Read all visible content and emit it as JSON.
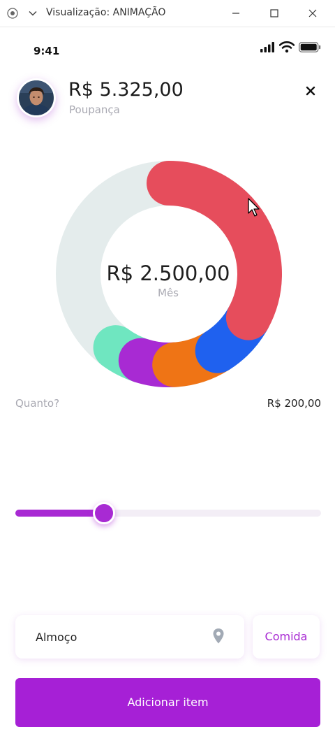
{
  "window": {
    "title": "Visualização: ANIMAÇÃO"
  },
  "status_bar": {
    "time": "9:41",
    "icons": [
      "signal-icon",
      "wifi-icon",
      "battery-icon"
    ]
  },
  "header": {
    "balance": "R$ 5.325,00",
    "account": "Poupança",
    "close_icon": "close-icon"
  },
  "chart": {
    "center_amount": "R$ 2.500,00",
    "center_period": "Mês",
    "track_color": "#e4ecec",
    "segments": [
      {
        "color": "#e64d5c",
        "share": 0.33
      },
      {
        "color": "#1f61ef",
        "share": 0.08
      },
      {
        "color": "#ef7415",
        "share": 0.08
      },
      {
        "color": "#a82ad3",
        "share": 0.06
      },
      {
        "color": "#6fe6c0",
        "share": 0.05
      }
    ]
  },
  "amount": {
    "label": "Quanto?",
    "value": "R$ 200,00"
  },
  "slider": {
    "value_fraction": 0.29,
    "color": "#a82ad3"
  },
  "form": {
    "item_value": "Almoço",
    "category": "Comida",
    "submit_label": "Adicionar item"
  },
  "colors": {
    "accent": "#a620d6",
    "muted_text": "#a9a9b2"
  }
}
